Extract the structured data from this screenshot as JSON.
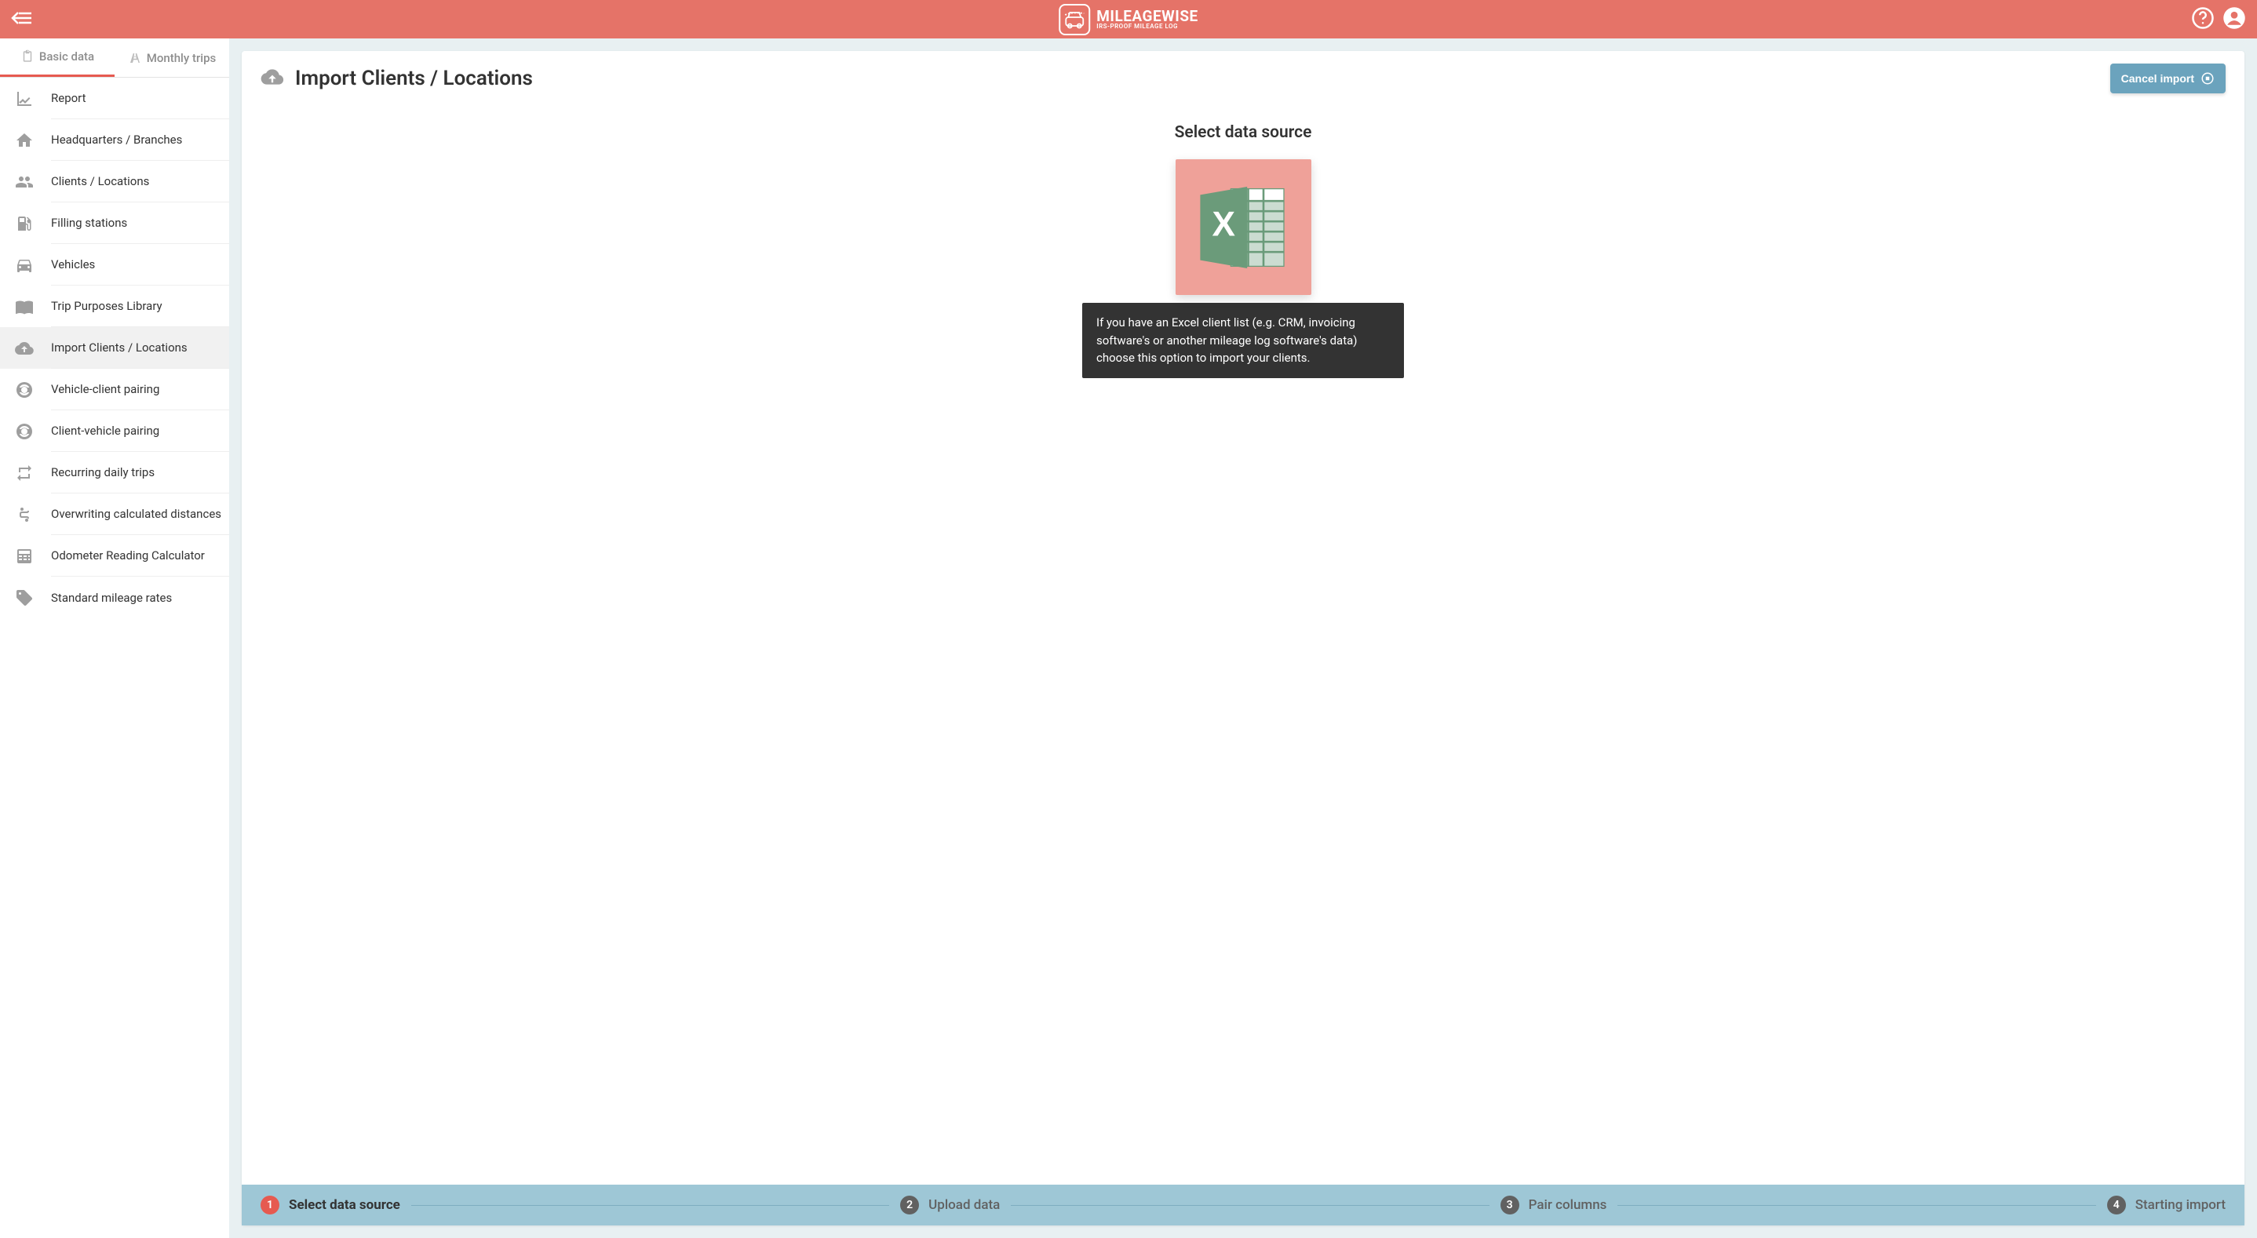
{
  "header": {
    "brand_main": "MILEAGEWISE",
    "brand_sub": "IRS-PROOF MILEAGE LOG"
  },
  "tabs": {
    "basic": "Basic data",
    "monthly": "Monthly trips"
  },
  "nav": [
    {
      "id": "report",
      "label": "Report",
      "icon": "chart-line-icon"
    },
    {
      "id": "hq",
      "label": "Headquarters / Branches",
      "icon": "building-icon"
    },
    {
      "id": "clients",
      "label": "Clients / Locations",
      "icon": "people-icon"
    },
    {
      "id": "filling",
      "label": "Filling stations",
      "icon": "fuel-icon"
    },
    {
      "id": "vehicles",
      "label": "Vehicles",
      "icon": "car-icon"
    },
    {
      "id": "purposes",
      "label": "Trip Purposes Library",
      "icon": "book-icon"
    },
    {
      "id": "import",
      "label": "Import Clients / Locations",
      "icon": "cloud-upload-icon",
      "active": true
    },
    {
      "id": "vc-pairing",
      "label": "Vehicle-client pairing",
      "icon": "pairing-icon"
    },
    {
      "id": "cv-pairing",
      "label": "Client-vehicle pairing",
      "icon": "pairing-icon"
    },
    {
      "id": "recurring",
      "label": "Recurring daily trips",
      "icon": "repeat-icon"
    },
    {
      "id": "overwriting",
      "label": "Overwriting calculated distances",
      "icon": "route-icon"
    },
    {
      "id": "odometer",
      "label": "Odometer Reading Calculator",
      "icon": "calculator-icon"
    },
    {
      "id": "rates",
      "label": "Standard mileage rates",
      "icon": "tags-icon"
    }
  ],
  "page": {
    "title": "Import Clients / Locations",
    "cancel_label": "Cancel import",
    "source_heading": "Select data source",
    "tooltip": "If you have an Excel client list (e.g. CRM, invoicing software's or another mileage log software's data) choose this option to import your clients."
  },
  "stepper": [
    {
      "num": "1",
      "label": "Select data source",
      "active": true
    },
    {
      "num": "2",
      "label": "Upload data"
    },
    {
      "num": "3",
      "label": "Pair columns"
    },
    {
      "num": "4",
      "label": "Starting import"
    }
  ]
}
